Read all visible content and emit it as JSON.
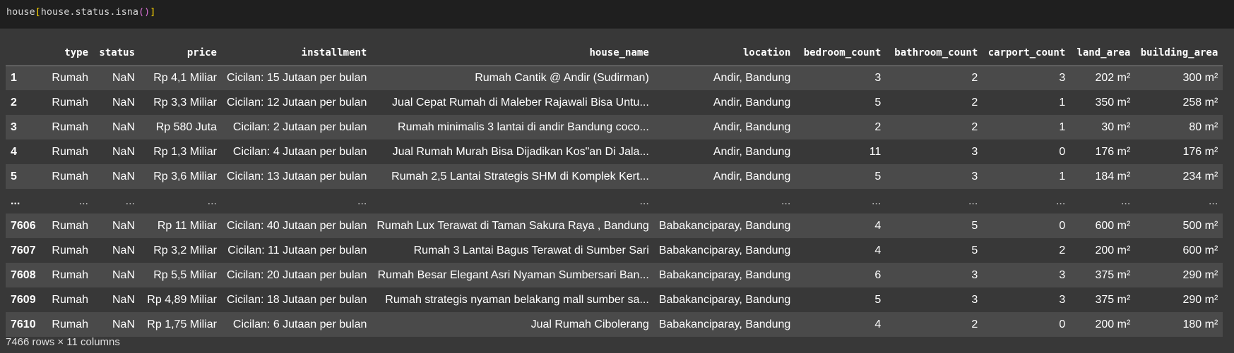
{
  "code": {
    "prefix": "house",
    "open_sq": "[",
    "middle": "house.status.isna",
    "parens": "()",
    "close_sq": "]"
  },
  "table": {
    "columns": [
      "",
      "type",
      "status",
      "price",
      "installment",
      "house_name",
      "location",
      "bedroom_count",
      "bathroom_count",
      "carport_count",
      "land_area",
      "building_area"
    ],
    "rows": [
      [
        "1",
        "Rumah",
        "NaN",
        "Rp 4,1 Miliar",
        "Cicilan: 15 Jutaan per bulan",
        "Rumah Cantik @ Andir (Sudirman)",
        "Andir, Bandung",
        "3",
        "2",
        "3",
        "202 m²",
        "300 m²"
      ],
      [
        "2",
        "Rumah",
        "NaN",
        "Rp 3,3 Miliar",
        "Cicilan: 12 Jutaan per bulan",
        "Jual Cepat Rumah di Maleber Rajawali Bisa Untu...",
        "Andir, Bandung",
        "5",
        "2",
        "1",
        "350 m²",
        "258 m²"
      ],
      [
        "3",
        "Rumah",
        "NaN",
        "Rp 580 Juta",
        "Cicilan: 2 Jutaan per bulan",
        "Rumah minimalis 3 lantai di andir Bandung coco...",
        "Andir, Bandung",
        "2",
        "2",
        "1",
        "30 m²",
        "80 m²"
      ],
      [
        "4",
        "Rumah",
        "NaN",
        "Rp 1,3 Miliar",
        "Cicilan: 4 Jutaan per bulan",
        "Jual Rumah Murah Bisa Dijadikan Kos\"an Di Jala...",
        "Andir, Bandung",
        "11",
        "3",
        "0",
        "176 m²",
        "176 m²"
      ],
      [
        "5",
        "Rumah",
        "NaN",
        "Rp 3,6 Miliar",
        "Cicilan: 13 Jutaan per bulan",
        "Rumah 2,5 Lantai Strategis SHM di Komplek Kert...",
        "Andir, Bandung",
        "5",
        "3",
        "1",
        "184 m²",
        "234 m²"
      ],
      [
        "...",
        "...",
        "...",
        "...",
        "...",
        "...",
        "...",
        "...",
        "...",
        "...",
        "...",
        "..."
      ],
      [
        "7606",
        "Rumah",
        "NaN",
        "Rp 11 Miliar",
        "Cicilan: 40 Jutaan per bulan",
        "Rumah Lux Terawat di Taman Sakura Raya , Bandung",
        "Babakanciparay, Bandung",
        "4",
        "5",
        "0",
        "600 m²",
        "500 m²"
      ],
      [
        "7607",
        "Rumah",
        "NaN",
        "Rp 3,2 Miliar",
        "Cicilan: 11 Jutaan per bulan",
        "Rumah 3 Lantai Bagus Terawat di Sumber Sari",
        "Babakanciparay, Bandung",
        "4",
        "5",
        "2",
        "200 m²",
        "600 m²"
      ],
      [
        "7608",
        "Rumah",
        "NaN",
        "Rp 5,5 Miliar",
        "Cicilan: 20 Jutaan per bulan",
        "Rumah Besar Elegant Asri Nyaman Sumbersari Ban...",
        "Babakanciparay, Bandung",
        "6",
        "3",
        "3",
        "375 m²",
        "290 m²"
      ],
      [
        "7609",
        "Rumah",
        "NaN",
        "Rp 4,89 Miliar",
        "Cicilan: 18 Jutaan per bulan",
        "Rumah strategis nyaman belakang mall sumber sa...",
        "Babakanciparay, Bandung",
        "5",
        "3",
        "3",
        "375 m²",
        "290 m²"
      ],
      [
        "7610",
        "Rumah",
        "NaN",
        "Rp 1,75 Miliar",
        "Cicilan: 6 Jutaan per bulan",
        "Jual Rumah Cibolerang",
        "Babakanciparay, Bandung",
        "4",
        "2",
        "0",
        "200 m²",
        "180 m²"
      ]
    ]
  },
  "footer": "7466 rows × 11 columns"
}
